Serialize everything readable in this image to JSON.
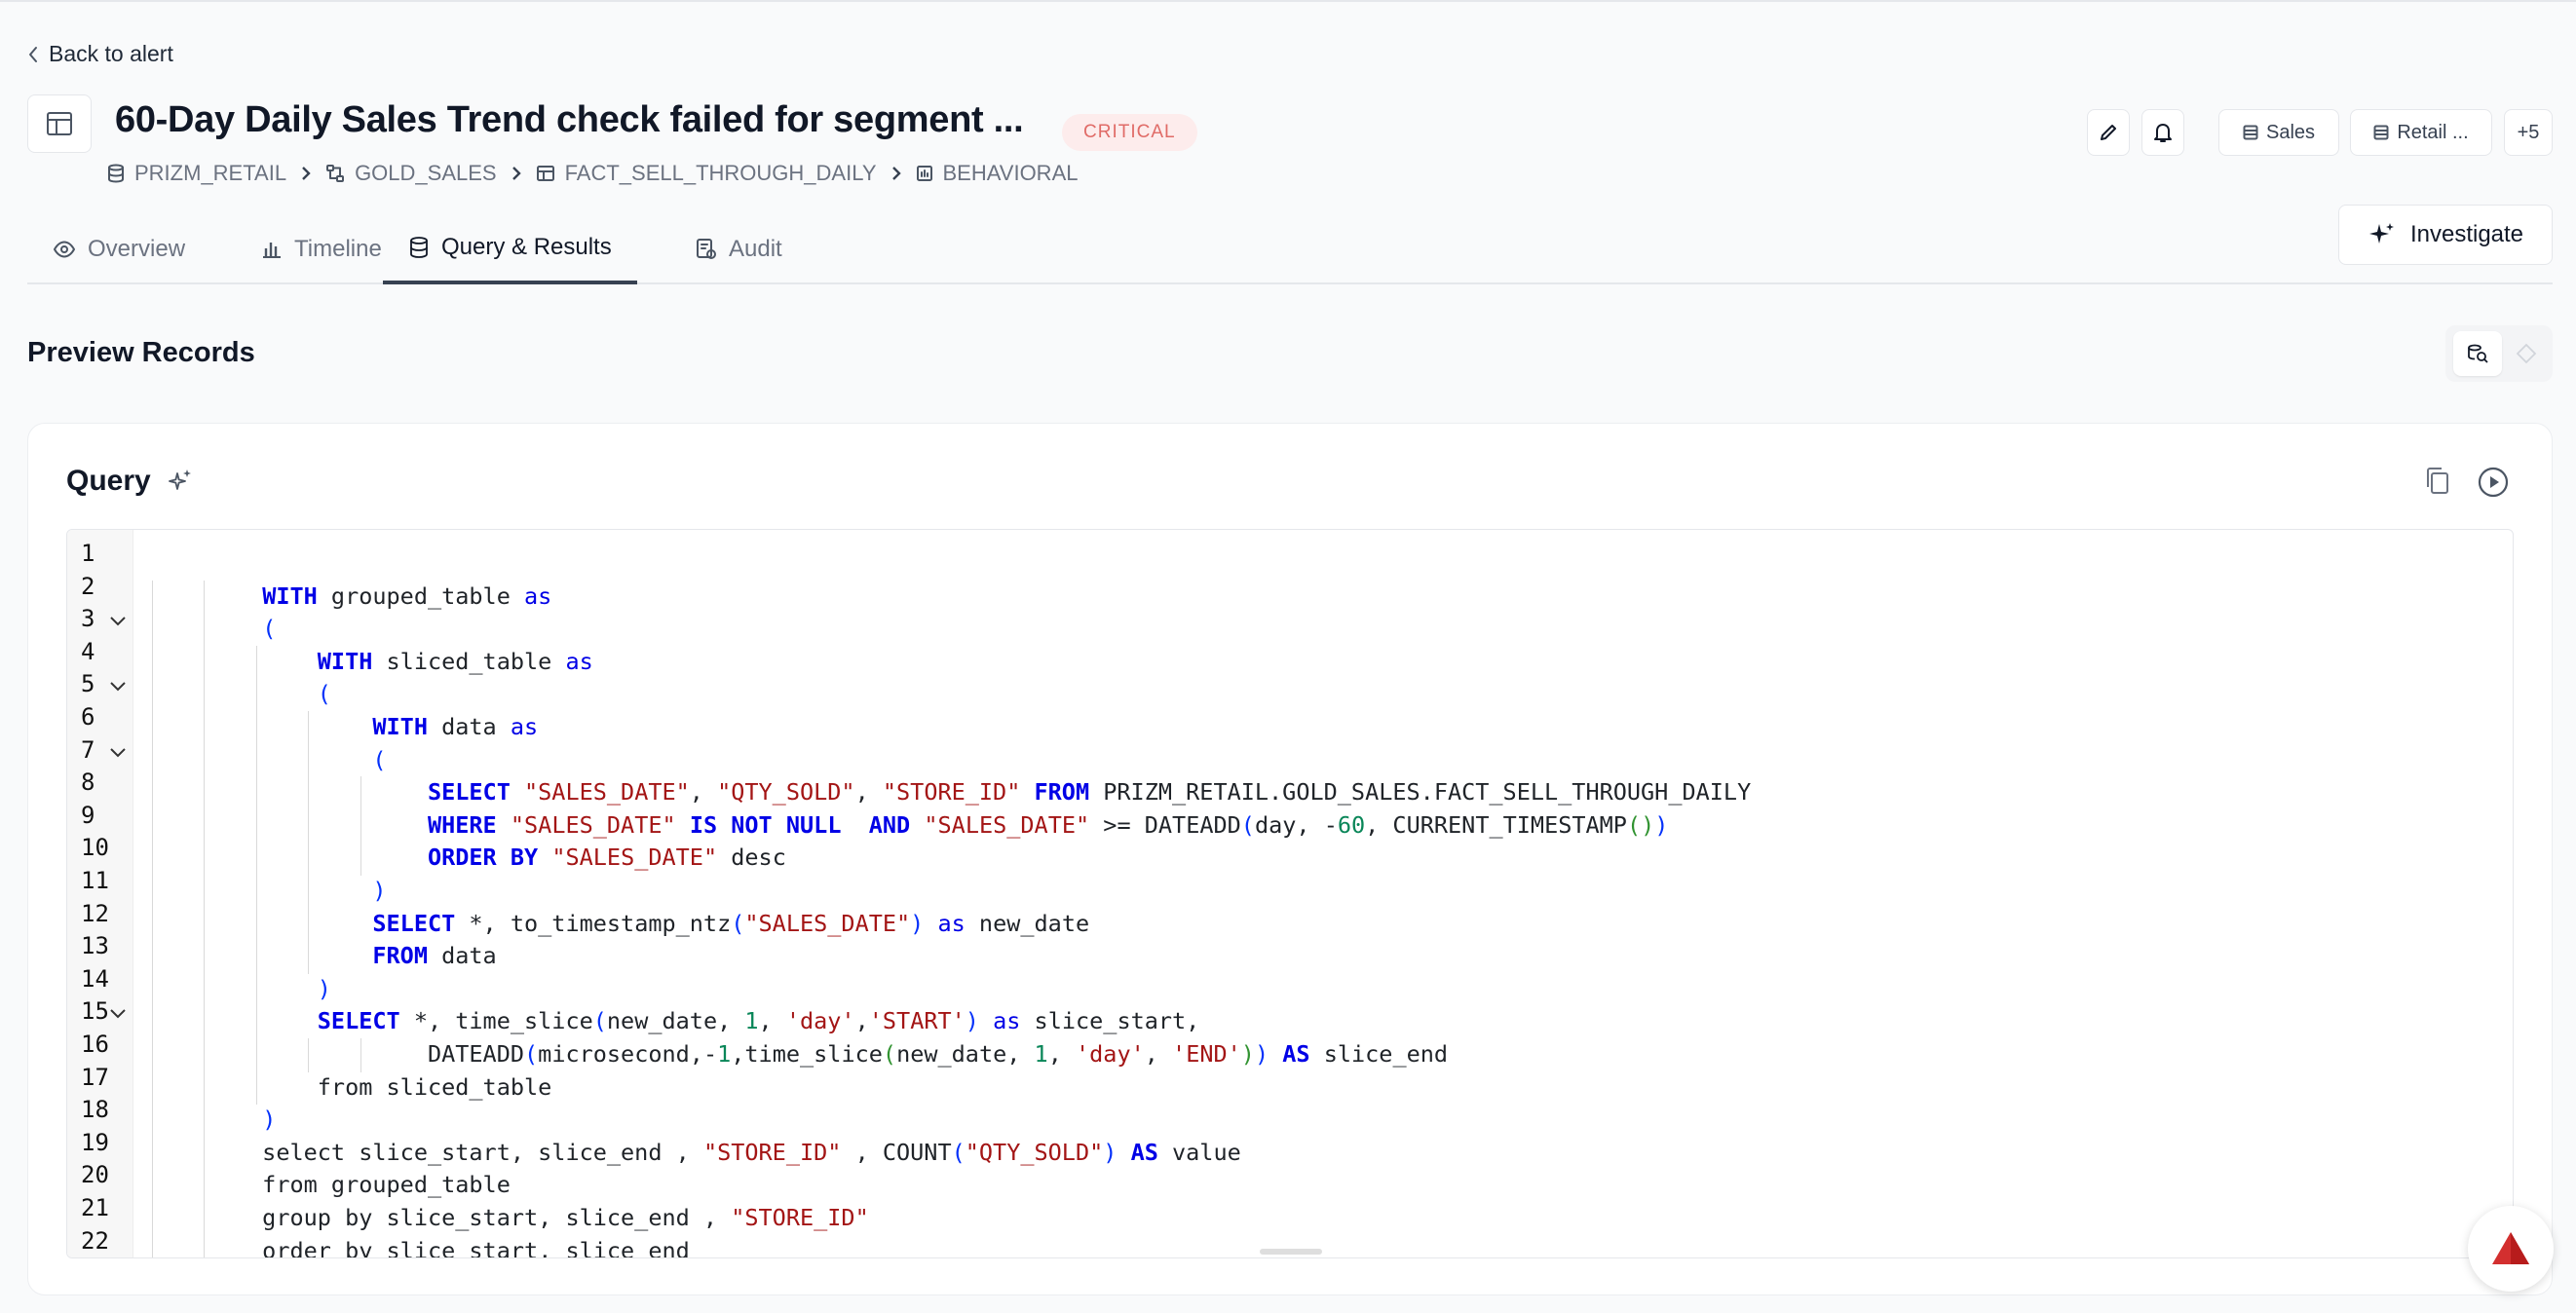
{
  "nav": {
    "back_label": "Back to alert"
  },
  "header": {
    "title": "60-Day Daily Sales Trend check failed for segment ...",
    "severity": "CRITICAL",
    "breadcrumb": [
      "PRIZM_RETAIL",
      "GOLD_SALES",
      "FACT_SELL_THROUGH_DAILY",
      "BEHAVIORAL"
    ],
    "tags": [
      "Sales",
      "Retail ..."
    ],
    "more_tags": "+5"
  },
  "tabs": [
    {
      "label": "Overview",
      "active": false
    },
    {
      "label": "Timeline",
      "active": false
    },
    {
      "label": "Query & Results",
      "active": true
    },
    {
      "label": "Audit",
      "active": false
    }
  ],
  "investigate_label": "Investigate",
  "section_title": "Preview Records",
  "query": {
    "title": "Query",
    "line_numbers": [
      "1",
      "2",
      "3",
      "4",
      "5",
      "6",
      "7",
      "8",
      "9",
      "10",
      "11",
      "12",
      "13",
      "14",
      "15",
      "16",
      "17",
      "18",
      "19",
      "20",
      "21",
      "22"
    ],
    "lines": [
      "",
      "        WITH grouped_table as",
      "        (",
      "            WITH sliced_table as",
      "            (",
      "                WITH data as",
      "                (",
      "                    SELECT \"SALES_DATE\", \"QTY_SOLD\", \"STORE_ID\" FROM PRIZM_RETAIL.GOLD_SALES.FACT_SELL_THROUGH_DAILY",
      "                    WHERE \"SALES_DATE\" IS NOT NULL  AND \"SALES_DATE\" >= DATEADD(day, -60, CURRENT_TIMESTAMP())",
      "                    ORDER BY \"SALES_DATE\" desc",
      "                )",
      "                SELECT *, to_timestamp_ntz(\"SALES_DATE\") as new_date",
      "                FROM data",
      "            )",
      "            SELECT *, time_slice(new_date, 1, 'day','START') as slice_start,",
      "                    DATEADD(microsecond,-1,time_slice(new_date, 1, 'day', 'END')) AS slice_end",
      "            from sliced_table",
      "        )",
      "        select slice_start, slice_end , \"STORE_ID\" , COUNT(\"QTY_SOLD\") AS value",
      "        from grouped_table",
      "        group by slice_start, slice_end , \"STORE_ID\"",
      "        order by slice_start, slice_end"
    ]
  },
  "colors": {
    "accent_logo": "#d32f2f",
    "severity_bg": "#fdecec",
    "severity_text": "#e06b67"
  },
  "icons": [
    "chevron-left-icon",
    "table-icon",
    "database-icon",
    "schema-icon",
    "grid-icon",
    "edit-icon",
    "bell-icon",
    "tag-icon",
    "eye-icon",
    "bar-chart-icon",
    "stack-icon",
    "audit-icon",
    "sparkle-icon",
    "copy-icon",
    "play-icon",
    "zoom-icon",
    "diamond-icon",
    "chevron-down-icon"
  ]
}
